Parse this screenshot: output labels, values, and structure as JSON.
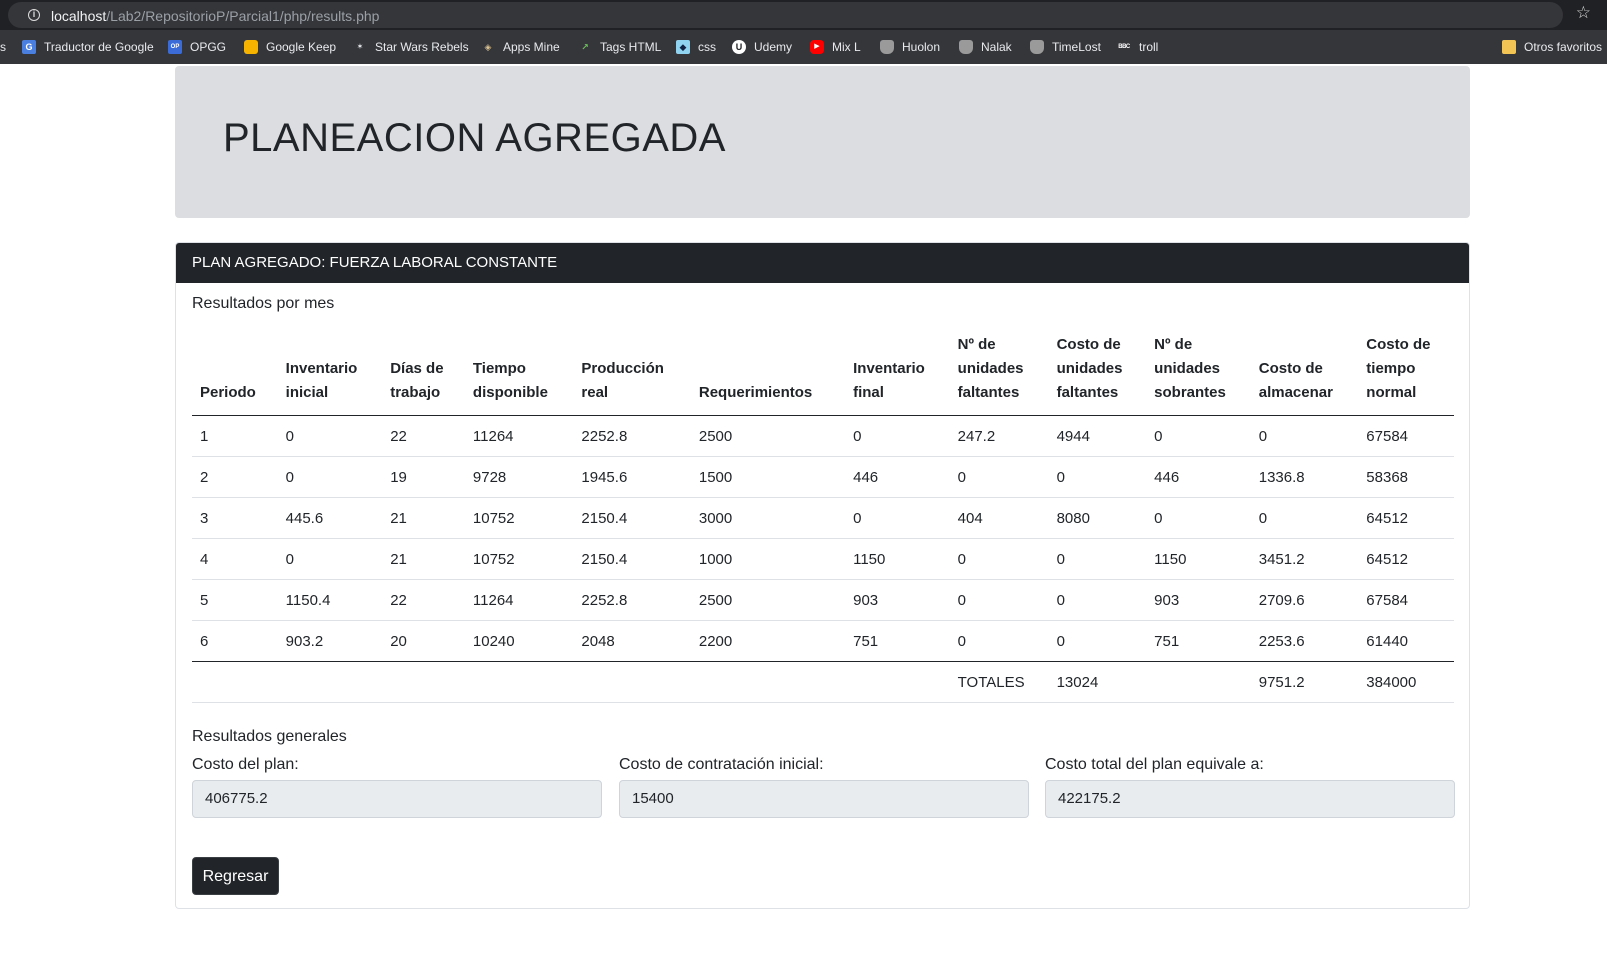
{
  "browser": {
    "url_host": "localhost",
    "url_path": "/Lab2/RepositorioP/Parcial1/php/results.php",
    "bookmarks": [
      {
        "label": "s",
        "icon": "none"
      },
      {
        "label": "Traductor de Google",
        "icon": "google-translate-icon"
      },
      {
        "label": "OPGG",
        "icon": "opgg-icon"
      },
      {
        "label": "Google Keep",
        "icon": "google-keep-icon"
      },
      {
        "label": "Star Wars Rebels",
        "icon": "star-wars-icon"
      },
      {
        "label": "Apps Mine",
        "icon": "apps-icon"
      },
      {
        "label": "Tags HTML",
        "icon": "chart-icon"
      },
      {
        "label": "css",
        "icon": "css-icon"
      },
      {
        "label": "Udemy",
        "icon": "udemy-icon"
      },
      {
        "label": "Mix L",
        "icon": "youtube-icon"
      },
      {
        "label": "Huolon",
        "icon": "wolf-icon"
      },
      {
        "label": "Nalak",
        "icon": "wolf-icon"
      },
      {
        "label": "TimeLost",
        "icon": "wolf-icon"
      },
      {
        "label": "troll",
        "icon": "bbc-icon"
      },
      {
        "label": "Otros favoritos",
        "icon": "folder-icon"
      }
    ]
  },
  "jumbotron": {
    "title": "PLANEACION AGREGADA"
  },
  "card": {
    "header": "PLAN AGREGADO: FUERZA LABORAL CONSTANTE",
    "monthly_title": "Resultados por mes",
    "table": {
      "headers": [
        [
          "Periodo"
        ],
        [
          "Inventario",
          "inicial"
        ],
        [
          "Días de",
          "trabajo"
        ],
        [
          "Tiempo",
          "disponible"
        ],
        [
          "Producción",
          "real"
        ],
        [
          "Requerimientos"
        ],
        [
          "Inventario",
          "final"
        ],
        [
          "Nº de",
          "unidades",
          "faltantes"
        ],
        [
          "Costo de",
          "unidades",
          "faltantes"
        ],
        [
          "Nº de",
          "unidades",
          "sobrantes"
        ],
        [
          "Costo de",
          "almacenar"
        ],
        [
          "Costo de",
          "tiempo",
          "normal"
        ]
      ],
      "rows": [
        [
          "1",
          "0",
          "22",
          "11264",
          "2252.8",
          "2500",
          "0",
          "247.2",
          "4944",
          "0",
          "0",
          "67584"
        ],
        [
          "2",
          "0",
          "19",
          "9728",
          "1945.6",
          "1500",
          "446",
          "0",
          "0",
          "446",
          "1336.8",
          "58368"
        ],
        [
          "3",
          "445.6",
          "21",
          "10752",
          "2150.4",
          "3000",
          "0",
          "404",
          "8080",
          "0",
          "0",
          "64512"
        ],
        [
          "4",
          "0",
          "21",
          "10752",
          "2150.4",
          "1000",
          "1150",
          "0",
          "0",
          "1150",
          "3451.2",
          "64512"
        ],
        [
          "5",
          "1150.4",
          "22",
          "11264",
          "2252.8",
          "2500",
          "903",
          "0",
          "0",
          "903",
          "2709.6",
          "67584"
        ],
        [
          "6",
          "903.2",
          "20",
          "10240",
          "2048",
          "2200",
          "751",
          "0",
          "0",
          "751",
          "2253.6",
          "61440"
        ]
      ],
      "totals": [
        "",
        "",
        "",
        "",
        "",
        "",
        "",
        "TOTALES",
        "13024",
        "",
        "9751.2",
        "384000"
      ]
    },
    "general_title": "Resultados generales",
    "fields": [
      {
        "label": "Costo del plan:",
        "value": "406775.2"
      },
      {
        "label": "Costo de contratación inicial:",
        "value": "15400"
      },
      {
        "label": "Costo total del plan equivale a:",
        "value": "422175.2"
      }
    ],
    "back_button": "Regresar"
  }
}
